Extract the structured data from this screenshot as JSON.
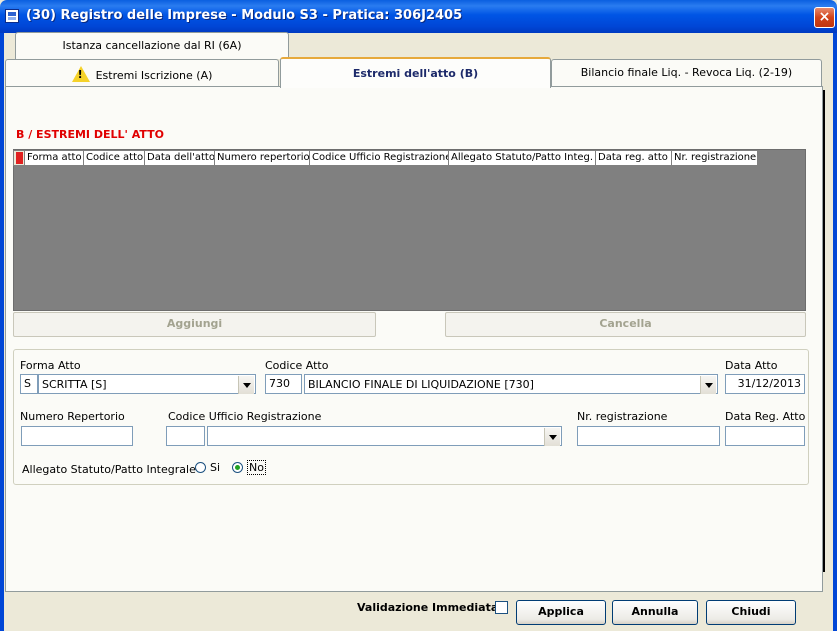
{
  "window": {
    "title": "(30) Registro delle Imprese - Modulo S3 - Pratica: 306J2405",
    "close_label": "×"
  },
  "tabs": {
    "top_row": [
      "Istanza cancellazione dal RI (6A)"
    ],
    "bottom_row": [
      {
        "label": "Estremi Iscrizione (A)",
        "icon": "warning-icon"
      },
      {
        "label": "Estremi dell'atto (B)",
        "active": true
      },
      {
        "label": "Bilancio finale Liq. - Revoca Liq. (2-19)"
      }
    ]
  },
  "section": {
    "title": "B / ESTREMI DELL' ATTO"
  },
  "grid": {
    "columns": [
      "Forma atto",
      "Codice atto",
      "Data dell'atto",
      "Numero repertorio",
      "Codice Ufficio Registrazione",
      "Allegato Statuto/Patto Integ.",
      "Data reg. atto",
      "Nr. registrazione"
    ],
    "rows": []
  },
  "grid_buttons": {
    "add": "Aggiungi",
    "delete": "Cancella"
  },
  "form": {
    "forma_atto": {
      "label": "Forma Atto",
      "code": "S",
      "value": "SCRITTA [S]"
    },
    "codice_atto": {
      "label": "Codice Atto",
      "code": "730",
      "value": "BILANCIO FINALE DI LIQUIDAZIONE [730]"
    },
    "data_atto": {
      "label": "Data Atto",
      "value": "31/12/2013"
    },
    "numero_repertorio": {
      "label": "Numero Repertorio",
      "value": ""
    },
    "codice_ufficio": {
      "label": "Codice Ufficio Registrazione",
      "code": "",
      "value": ""
    },
    "nr_registrazione": {
      "label": "Nr. registrazione",
      "value": ""
    },
    "data_reg_atto": {
      "label": "Data Reg. Atto",
      "value": ""
    },
    "allegato": {
      "label": "Allegato Statuto/Patto Integrale",
      "options": [
        "Si",
        "No"
      ],
      "selected": "No"
    }
  },
  "footer": {
    "validation_label": "Validazione Immediata",
    "validation_checked": false,
    "apply_label": "Applica",
    "cancel_label": "Annulla",
    "close_label": "Chiudi"
  }
}
